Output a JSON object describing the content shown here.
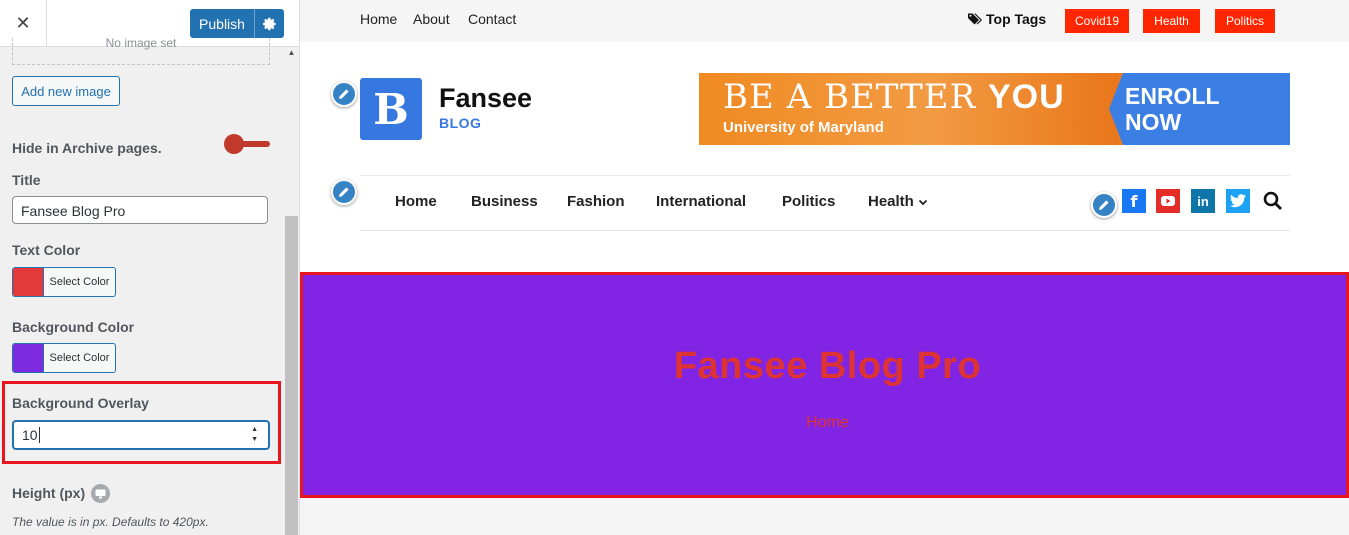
{
  "sidebar": {
    "close_label": "✕",
    "publish_label": "Publish",
    "no_image_text": "No image set",
    "add_image_label": "Add new image",
    "hide_archive_label": "Hide in Archive pages.",
    "title_label": "Title",
    "title_value": "Fansee Blog Pro",
    "text_color_label": "Text Color",
    "text_color": "#dd3333",
    "select_color_label": "Select Color",
    "bg_color_label": "Background Color",
    "bg_color": "#8224e3",
    "overlay_label": "Background Overlay",
    "overlay_value": "10",
    "height_label": "Height (px)",
    "height_desc": "The value is in px. Defaults to 420px."
  },
  "preview": {
    "top_links": [
      "Home",
      "About",
      "Contact"
    ],
    "top_tags_label": "Top Tags",
    "tags": [
      "Covid19",
      "Health",
      "Politics"
    ],
    "logo_letter": "B",
    "site_title": "Fansee",
    "site_tagline": "BLOG",
    "ad": {
      "line1_a": "BE A BETTER ",
      "line1_b": "YOU",
      "line2": "University of Maryland",
      "cta_1": "ENROLL",
      "cta_2": "NOW"
    },
    "nav": [
      "Home",
      "Business",
      "Fashion",
      "International",
      "Politics",
      "Health"
    ],
    "header_title": "Fansee Blog Pro",
    "breadcrumb": "Home"
  },
  "colors": {
    "accent": "#2271b1",
    "tag_bg": "#ff2600",
    "highlight_border": "#e8151e",
    "facebook": "#1877f2",
    "youtube": "#e52d27",
    "linkedin": "#0e76a8",
    "twitter": "#1da1f2"
  }
}
